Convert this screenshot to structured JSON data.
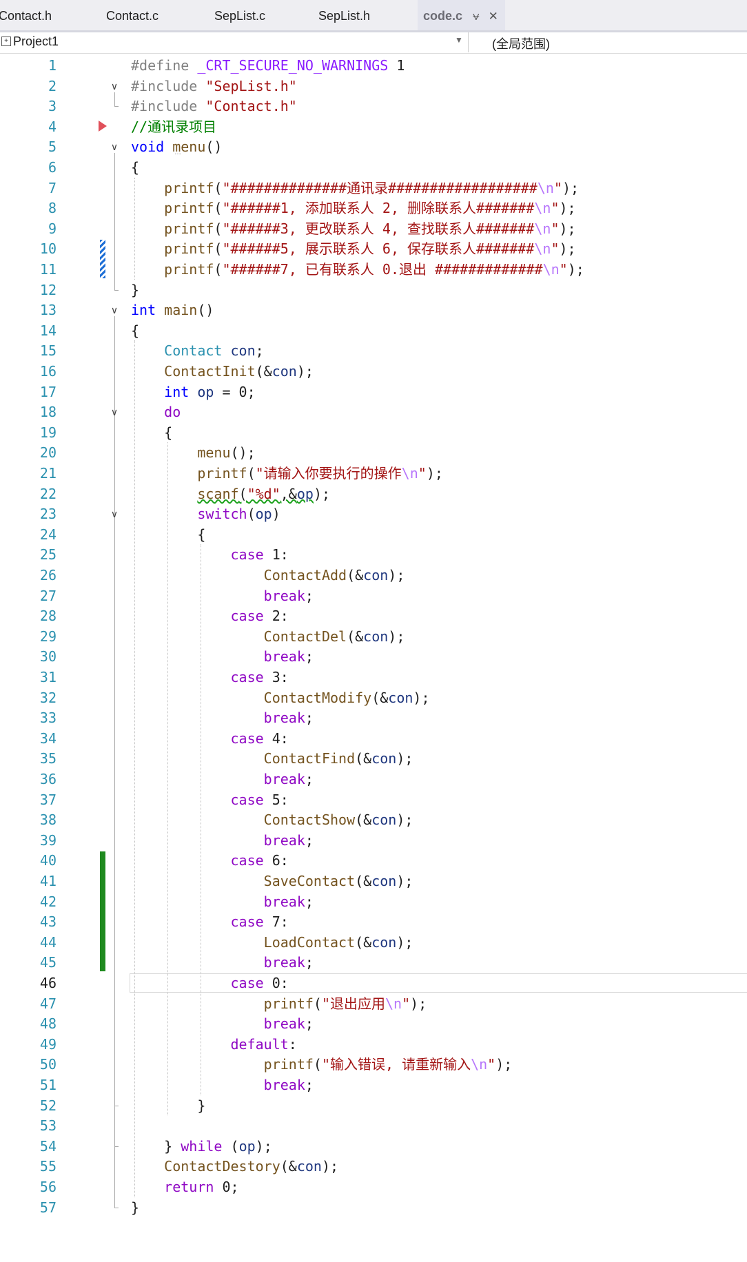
{
  "tabs": [
    {
      "label": "Contact.h",
      "active": false
    },
    {
      "label": "Contact.c",
      "active": false
    },
    {
      "label": "SepList.c",
      "active": false
    },
    {
      "label": "SepList.h",
      "active": false
    },
    {
      "label": "code.c",
      "active": true
    }
  ],
  "tab_icons": {
    "pin": "pin-icon",
    "close": "close-icon"
  },
  "navbar": {
    "project": "Project1",
    "scope": "(全局范围)"
  },
  "editor": {
    "current_line": 46
  },
  "colors": {
    "keyword": "#0000ff",
    "control": "#8f08c4",
    "string": "#a31515",
    "comment": "#008000",
    "line_number": "#2b91af",
    "change_saved": "#1f8a1f",
    "change_unsaved": "#1e6fd6"
  },
  "code_lines": [
    [
      [
        "pp",
        "#define "
      ],
      [
        "macro",
        "_CRT_SECURE_NO_WARNINGS"
      ],
      [
        "p",
        " 1"
      ]
    ],
    [
      [
        "pp",
        "#include "
      ],
      [
        "str",
        "\"SepList.h\""
      ]
    ],
    [
      [
        "pp",
        "#include "
      ],
      [
        "str",
        "\"Contact.h\""
      ]
    ],
    [
      [
        "cmt",
        "//通讯录项目"
      ]
    ],
    [
      [
        "kw",
        "void"
      ],
      [
        "p",
        " "
      ],
      [
        "fn",
        "menu"
      ],
      [
        "p",
        "()"
      ]
    ],
    [
      [
        "p",
        "{"
      ]
    ],
    [
      [
        "p",
        "    "
      ],
      [
        "fn",
        "printf"
      ],
      [
        "p",
        "("
      ],
      [
        "str",
        "\"##############通讯录##################"
      ],
      [
        "esc",
        "\\n"
      ],
      [
        "str",
        "\""
      ],
      [
        "p",
        ");"
      ]
    ],
    [
      [
        "p",
        "    "
      ],
      [
        "fn",
        "printf"
      ],
      [
        "p",
        "("
      ],
      [
        "str",
        "\"######1, 添加联系人 2, 删除联系人#######"
      ],
      [
        "esc",
        "\\n"
      ],
      [
        "str",
        "\""
      ],
      [
        "p",
        ");"
      ]
    ],
    [
      [
        "p",
        "    "
      ],
      [
        "fn",
        "printf"
      ],
      [
        "p",
        "("
      ],
      [
        "str",
        "\"######3, 更改联系人 4, 查找联系人#######"
      ],
      [
        "esc",
        "\\n"
      ],
      [
        "str",
        "\""
      ],
      [
        "p",
        ");"
      ]
    ],
    [
      [
        "p",
        "    "
      ],
      [
        "fn",
        "printf"
      ],
      [
        "p",
        "("
      ],
      [
        "str",
        "\"######5, 展示联系人 6, 保存联系人#######"
      ],
      [
        "esc",
        "\\n"
      ],
      [
        "str",
        "\""
      ],
      [
        "p",
        ");"
      ]
    ],
    [
      [
        "p",
        "    "
      ],
      [
        "fn",
        "printf"
      ],
      [
        "p",
        "("
      ],
      [
        "str",
        "\"######7, 已有联系人 0.退出 #############"
      ],
      [
        "esc",
        "\\n"
      ],
      [
        "str",
        "\""
      ],
      [
        "p",
        ");"
      ]
    ],
    [
      [
        "p",
        "}"
      ]
    ],
    [
      [
        "kw",
        "int"
      ],
      [
        "p",
        " "
      ],
      [
        "fn",
        "main"
      ],
      [
        "p",
        "()"
      ]
    ],
    [
      [
        "p",
        "{"
      ]
    ],
    [
      [
        "p",
        "    "
      ],
      [
        "type",
        "Contact"
      ],
      [
        "p",
        " "
      ],
      [
        "var",
        "con"
      ],
      [
        "p",
        ";"
      ]
    ],
    [
      [
        "p",
        "    "
      ],
      [
        "fn",
        "ContactInit"
      ],
      [
        "p",
        "(&"
      ],
      [
        "var",
        "con"
      ],
      [
        "p",
        ");"
      ]
    ],
    [
      [
        "p",
        "    "
      ],
      [
        "kw",
        "int"
      ],
      [
        "p",
        " "
      ],
      [
        "var",
        "op"
      ],
      [
        "p",
        " = 0;"
      ]
    ],
    [
      [
        "p",
        "    "
      ],
      [
        "ctl",
        "do"
      ]
    ],
    [
      [
        "p",
        "    {"
      ]
    ],
    [
      [
        "p",
        "        "
      ],
      [
        "fn",
        "menu"
      ],
      [
        "p",
        "();"
      ]
    ],
    [
      [
        "p",
        "        "
      ],
      [
        "fn",
        "printf"
      ],
      [
        "p",
        "("
      ],
      [
        "str",
        "\"请输入你要执行的操作"
      ],
      [
        "esc",
        "\\n"
      ],
      [
        "str",
        "\""
      ],
      [
        "p",
        ");"
      ]
    ],
    [
      [
        "p",
        "        "
      ],
      [
        "sq_fn",
        "scanf"
      ],
      [
        "sq_p",
        "("
      ],
      [
        "sq_str",
        "\"%d\""
      ],
      [
        "sq_p",
        ",&"
      ],
      [
        "sq_var",
        "op"
      ],
      [
        "p",
        ");"
      ]
    ],
    [
      [
        "p",
        "        "
      ],
      [
        "ctl",
        "switch"
      ],
      [
        "p",
        "("
      ],
      [
        "var",
        "op"
      ],
      [
        "p",
        ")"
      ]
    ],
    [
      [
        "p",
        "        {"
      ]
    ],
    [
      [
        "p",
        "            "
      ],
      [
        "ctl",
        "case"
      ],
      [
        "p",
        " 1:"
      ]
    ],
    [
      [
        "p",
        "                "
      ],
      [
        "fn",
        "ContactAdd"
      ],
      [
        "p",
        "(&"
      ],
      [
        "var",
        "con"
      ],
      [
        "p",
        ");"
      ]
    ],
    [
      [
        "p",
        "                "
      ],
      [
        "ctl",
        "break"
      ],
      [
        "p",
        ";"
      ]
    ],
    [
      [
        "p",
        "            "
      ],
      [
        "ctl",
        "case"
      ],
      [
        "p",
        " 2:"
      ]
    ],
    [
      [
        "p",
        "                "
      ],
      [
        "fn",
        "ContactDel"
      ],
      [
        "p",
        "(&"
      ],
      [
        "var",
        "con"
      ],
      [
        "p",
        ");"
      ]
    ],
    [
      [
        "p",
        "                "
      ],
      [
        "ctl",
        "break"
      ],
      [
        "p",
        ";"
      ]
    ],
    [
      [
        "p",
        "            "
      ],
      [
        "ctl",
        "case"
      ],
      [
        "p",
        " 3:"
      ]
    ],
    [
      [
        "p",
        "                "
      ],
      [
        "fn",
        "ContactModify"
      ],
      [
        "p",
        "(&"
      ],
      [
        "var",
        "con"
      ],
      [
        "p",
        ");"
      ]
    ],
    [
      [
        "p",
        "                "
      ],
      [
        "ctl",
        "break"
      ],
      [
        "p",
        ";"
      ]
    ],
    [
      [
        "p",
        "            "
      ],
      [
        "ctl",
        "case"
      ],
      [
        "p",
        " 4:"
      ]
    ],
    [
      [
        "p",
        "                "
      ],
      [
        "fn",
        "ContactFind"
      ],
      [
        "p",
        "(&"
      ],
      [
        "var",
        "con"
      ],
      [
        "p",
        ");"
      ]
    ],
    [
      [
        "p",
        "                "
      ],
      [
        "ctl",
        "break"
      ],
      [
        "p",
        ";"
      ]
    ],
    [
      [
        "p",
        "            "
      ],
      [
        "ctl",
        "case"
      ],
      [
        "p",
        " 5:"
      ]
    ],
    [
      [
        "p",
        "                "
      ],
      [
        "fn",
        "ContactShow"
      ],
      [
        "p",
        "(&"
      ],
      [
        "var",
        "con"
      ],
      [
        "p",
        ");"
      ]
    ],
    [
      [
        "p",
        "                "
      ],
      [
        "ctl",
        "break"
      ],
      [
        "p",
        ";"
      ]
    ],
    [
      [
        "p",
        "            "
      ],
      [
        "ctl",
        "case"
      ],
      [
        "p",
        " 6:"
      ]
    ],
    [
      [
        "p",
        "                "
      ],
      [
        "fn",
        "SaveContact"
      ],
      [
        "p",
        "(&"
      ],
      [
        "var",
        "con"
      ],
      [
        "p",
        ");"
      ]
    ],
    [
      [
        "p",
        "                "
      ],
      [
        "ctl",
        "break"
      ],
      [
        "p",
        ";"
      ]
    ],
    [
      [
        "p",
        "            "
      ],
      [
        "ctl",
        "case"
      ],
      [
        "p",
        " 7:"
      ]
    ],
    [
      [
        "p",
        "                "
      ],
      [
        "fn",
        "LoadContact"
      ],
      [
        "p",
        "(&"
      ],
      [
        "var",
        "con"
      ],
      [
        "p",
        ");"
      ]
    ],
    [
      [
        "p",
        "                "
      ],
      [
        "ctl",
        "break"
      ],
      [
        "p",
        ";"
      ]
    ],
    [
      [
        "p",
        "            "
      ],
      [
        "ctl",
        "case"
      ],
      [
        "p",
        " 0:"
      ]
    ],
    [
      [
        "p",
        "                "
      ],
      [
        "fn",
        "printf"
      ],
      [
        "p",
        "("
      ],
      [
        "str",
        "\"退出应用"
      ],
      [
        "esc",
        "\\n"
      ],
      [
        "str",
        "\""
      ],
      [
        "p",
        ");"
      ]
    ],
    [
      [
        "p",
        "                "
      ],
      [
        "ctl",
        "break"
      ],
      [
        "p",
        ";"
      ]
    ],
    [
      [
        "p",
        "            "
      ],
      [
        "ctl",
        "default"
      ],
      [
        "p",
        ":"
      ]
    ],
    [
      [
        "p",
        "                "
      ],
      [
        "fn",
        "printf"
      ],
      [
        "p",
        "("
      ],
      [
        "str",
        "\"输入错误, 请重新输入"
      ],
      [
        "esc",
        "\\n"
      ],
      [
        "str",
        "\""
      ],
      [
        "p",
        ");"
      ]
    ],
    [
      [
        "p",
        "                "
      ],
      [
        "ctl",
        "break"
      ],
      [
        "p",
        ";"
      ]
    ],
    [
      [
        "p",
        "        }"
      ]
    ],
    [
      [
        "p",
        ""
      ]
    ],
    [
      [
        "p",
        "    } "
      ],
      [
        "ctl",
        "while"
      ],
      [
        "p",
        " ("
      ],
      [
        "var",
        "op"
      ],
      [
        "p",
        ");"
      ]
    ],
    [
      [
        "p",
        "    "
      ],
      [
        "fn",
        "ContactDestory"
      ],
      [
        "p",
        "(&"
      ],
      [
        "var",
        "con"
      ],
      [
        "p",
        ");"
      ]
    ],
    [
      [
        "p",
        "    "
      ],
      [
        "ctl",
        "return"
      ],
      [
        "p",
        " 0;"
      ]
    ],
    [
      [
        "p",
        "}"
      ]
    ]
  ]
}
